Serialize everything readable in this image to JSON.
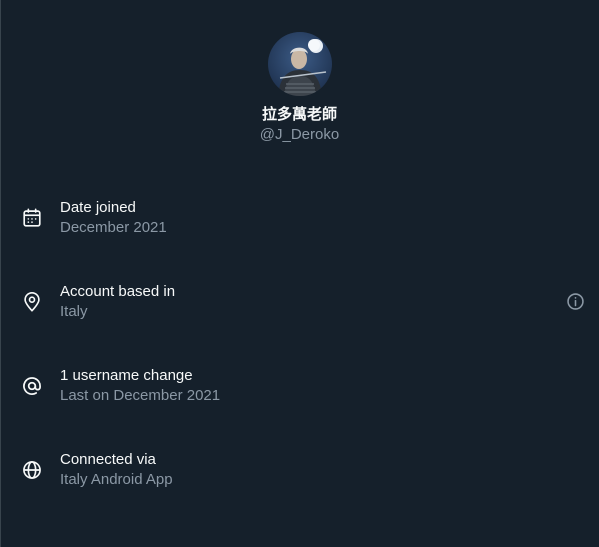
{
  "profile": {
    "display_name": "拉多萬老師",
    "handle": "@J_Deroko",
    "avatar_icon": "avatar"
  },
  "rows": [
    {
      "icon": "calendar-icon",
      "title": "Date joined",
      "value": "December 2021"
    },
    {
      "icon": "location-pin-icon",
      "title": "Account based in",
      "value": "Italy",
      "extra_icon": "info-icon"
    },
    {
      "icon": "at-sign-icon",
      "title": "1 username change",
      "value": "Last on December 2021"
    },
    {
      "icon": "globe-icon",
      "title": "Connected via",
      "value": "Italy Android App"
    }
  ],
  "colors": {
    "background": "#15202b",
    "primary_text": "#f7f9f9",
    "secondary_text": "#8b98a5"
  }
}
